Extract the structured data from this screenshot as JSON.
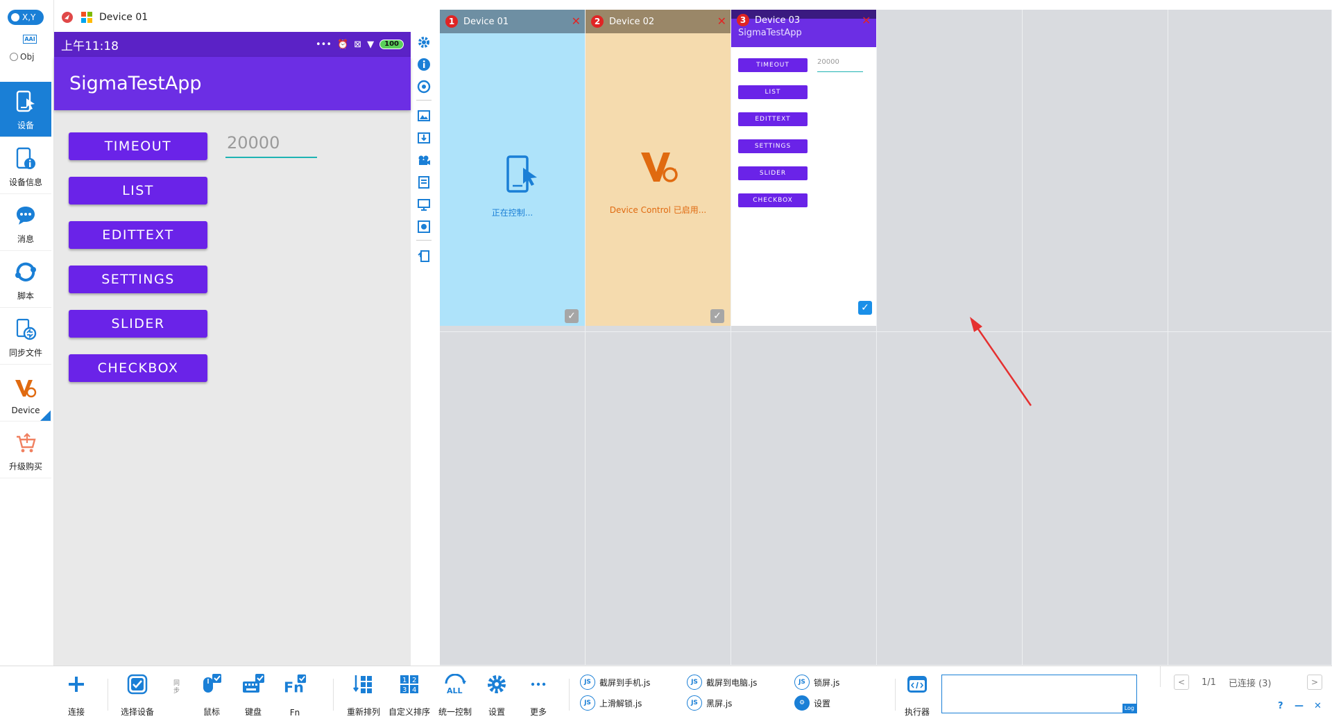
{
  "sidebar": {
    "mode_toggle": "X,Y",
    "aai_badge": "AAI",
    "obj_label": "Obj",
    "items": [
      {
        "label": "设备"
      },
      {
        "label": "设备信息"
      },
      {
        "label": "消息"
      },
      {
        "label": "脚本"
      },
      {
        "label": "同步文件"
      },
      {
        "label": "Device"
      },
      {
        "label": "升级购买"
      }
    ]
  },
  "device_view": {
    "title": "Device 01"
  },
  "phone": {
    "time": "上午11:18",
    "battery": "100",
    "app_title": "SigmaTestApp",
    "buttons": [
      "TIMEOUT",
      "LIST",
      "EDITTEXT",
      "SETTINGS",
      "SLIDER",
      "CHECKBOX"
    ],
    "timeout_value": "20000"
  },
  "grid": {
    "cards": [
      {
        "num": "1",
        "title": "Device 01",
        "status": "正在控制...",
        "header_color": "#6e8fa3",
        "body_color": "#aee3fa",
        "checked": false
      },
      {
        "num": "2",
        "title": "Device 02",
        "status": "Device Control 已启用...",
        "header_color": "#9a8768",
        "body_color": "#f5dbae",
        "checked": false
      },
      {
        "num": "3",
        "title": "Device 03",
        "app_title": "SigmaTestApp",
        "checked": true
      }
    ],
    "mini_buttons": [
      "TIMEOUT",
      "LIST",
      "EDITTEXT",
      "SETTINGS",
      "SLIDER",
      "CHECKBOX"
    ],
    "mini_value": "20000"
  },
  "bottombar": {
    "connect": "连接",
    "select_device": "选择设备",
    "sync": "同步",
    "mouse": "鼠标",
    "keyboard": "键盘",
    "fn": "Fn",
    "rearrange": "重新排列",
    "custom_sort": "自定义排序",
    "unified_control": "统一控制",
    "settings": "设置",
    "more": "更多",
    "scripts": [
      {
        "label": "截屏到手机.js"
      },
      {
        "label": "上滑解锁.js"
      },
      {
        "label": "截屏到电脑.js"
      },
      {
        "label": "黑屏.js"
      },
      {
        "label": "锁屏.js"
      },
      {
        "label": "设置"
      }
    ],
    "executor": "执行器",
    "log": "Log",
    "page": "1/1",
    "connected": "已连接 (3)"
  },
  "colors": {
    "accent": "#1a7fd6",
    "purple": "#6a23e8",
    "orange": "#e06a10"
  }
}
